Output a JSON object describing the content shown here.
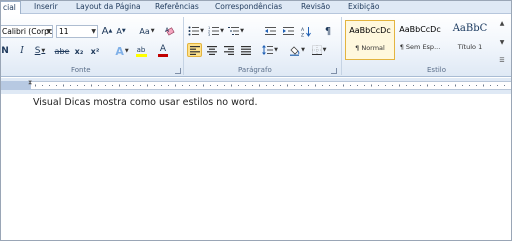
{
  "tabs": [
    {
      "label": "cial",
      "active": true
    },
    {
      "label": "Inserir"
    },
    {
      "label": "Layout da Página"
    },
    {
      "label": "Referências"
    },
    {
      "label": "Correspondências"
    },
    {
      "label": "Revisão"
    },
    {
      "label": "Exibição"
    }
  ],
  "font": {
    "name": "Calibri (Corpo",
    "size": "11",
    "group_label": "Fonte",
    "grow_label": "A",
    "shrink_label": "A",
    "case_label": "Aa",
    "bold": "N",
    "italic": "I",
    "underline": "S",
    "strike": "abe",
    "subscript": "x₂",
    "superscript": "x²",
    "effects": "A",
    "highlight": "ab",
    "color": "A"
  },
  "paragraph": {
    "group_label": "Parágrafo",
    "pilcrow": "¶"
  },
  "styles": {
    "group_label": "Estilo",
    "items": [
      {
        "preview": "AaBbCcDc",
        "name": "¶ Normal",
        "selected": true
      },
      {
        "preview": "AaBbCcDc",
        "name": "¶ Sem Esp..."
      },
      {
        "preview": "AaBbC",
        "name": "Título 1"
      }
    ]
  },
  "document": {
    "text": "Visual Dicas mostra como usar estilos no word."
  },
  "colors": {
    "highlight": "#ffff00",
    "font_color": "#c00000",
    "selected_style": "#e3b43f"
  }
}
